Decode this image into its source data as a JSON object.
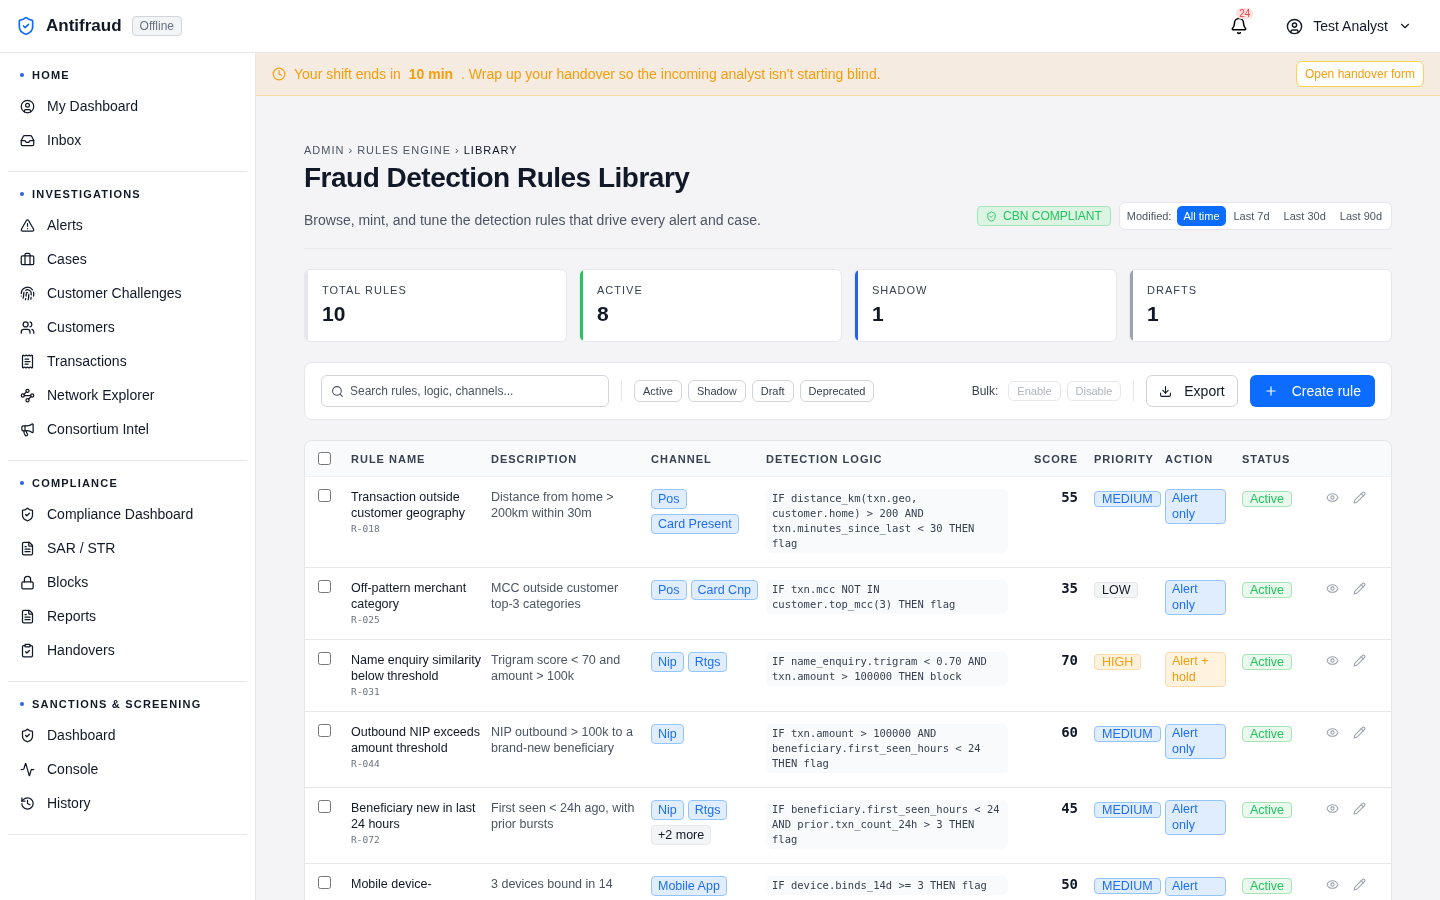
{
  "app": {
    "name": "Antifraud",
    "status": "Offline"
  },
  "header": {
    "notifications": "24",
    "user": "Test Analyst"
  },
  "sidebar": [
    {
      "title": "HOME",
      "items": [
        {
          "label": "My Dashboard"
        },
        {
          "label": "Inbox"
        }
      ]
    },
    {
      "title": "INVESTIGATIONS",
      "items": [
        {
          "label": "Alerts"
        },
        {
          "label": "Cases"
        },
        {
          "label": "Customer Challenges"
        },
        {
          "label": "Customers"
        },
        {
          "label": "Transactions"
        },
        {
          "label": "Network Explorer"
        },
        {
          "label": "Consortium Intel"
        }
      ]
    },
    {
      "title": "COMPLIANCE",
      "items": [
        {
          "label": "Compliance Dashboard"
        },
        {
          "label": "SAR / STR"
        },
        {
          "label": "Blocks"
        },
        {
          "label": "Reports"
        },
        {
          "label": "Handovers"
        }
      ]
    },
    {
      "title": "SANCTIONS & SCREENING",
      "items": [
        {
          "label": "Dashboard"
        },
        {
          "label": "Console"
        },
        {
          "label": "History"
        }
      ]
    }
  ],
  "banner": {
    "text": "Your shift ends in **10 min** . Wrap up your handover so the incoming analyst isn't starting blind.",
    "button": "Open handover form"
  },
  "breadcrumb": {
    "items": [
      "ADMIN",
      "RULES ENGINE",
      "LIBRARY"
    ],
    "separator": "›"
  },
  "title": "Fraud Detection Rules Library",
  "subtitle": "Browse, mint, and tune the detection rules that drive every alert and case.",
  "compliance_badge": "CBN COMPLIANT",
  "modified_filter": {
    "label": "Modified:",
    "options": [
      {
        "label": "All time",
        "selected": true
      },
      {
        "label": "Last 7d",
        "selected": false
      },
      {
        "label": "Last 30d",
        "selected": false
      },
      {
        "label": "Last 90d",
        "selected": false
      }
    ]
  },
  "stats": [
    {
      "label": "TOTAL RULES",
      "value": "10",
      "color": "#e5e7eb"
    },
    {
      "label": "ACTIVE",
      "value": "8",
      "color": "#22c55e"
    },
    {
      "label": "SHADOW",
      "value": "1",
      "color": "#2563eb"
    },
    {
      "label": "DRAFTS",
      "value": "1",
      "color": "#9ca3af"
    }
  ],
  "toolbar": {
    "search_placeholder": "Search rules, logic, channels...",
    "status_filters": [
      "Active",
      "Shadow",
      "Draft",
      "Deprecated"
    ],
    "bulk_label": "Bulk:",
    "bulk_actions": [
      {
        "label": "Enable",
        "disabled": true
      },
      {
        "label": "Disable",
        "disabled": true
      }
    ],
    "export": "Export",
    "create": "Create rule"
  },
  "table": {
    "all_checked": false,
    "columns": [
      "RULE NAME",
      "DESCRIPTION",
      "CHANNEL",
      "DETECTION LOGIC",
      "SCORE",
      "PRIORITY",
      "ACTION",
      "STATUS"
    ],
    "rows": [
      {
        "checked": false,
        "name": "Transaction outside customer geography",
        "id": "R-018",
        "description": "Distance from home > 200km within 30m",
        "channels": [
          {
            "label": "Pos",
            "kind": "channel"
          },
          {
            "label": "Card Present",
            "kind": "channel"
          }
        ],
        "logic": "IF distance_km(txn.geo, customer.home) > 200 AND txn.minutes_since_last < 30 THEN flag",
        "score": "55",
        "priority": {
          "label": "MEDIUM",
          "kind": "medium"
        },
        "action": {
          "label": "Alert only",
          "kind": "alert"
        },
        "status": {
          "label": "Active",
          "kind": "active"
        }
      },
      {
        "checked": false,
        "name": "Off-pattern merchant category",
        "id": "R-025",
        "description": "MCC outside customer top-3 categories",
        "channels": [
          {
            "label": "Pos",
            "kind": "channel"
          },
          {
            "label": "Card Cnp",
            "kind": "channel"
          }
        ],
        "logic": "IF txn.mcc NOT IN customer.top_mcc(3) THEN flag",
        "score": "35",
        "priority": {
          "label": "LOW",
          "kind": "low"
        },
        "action": {
          "label": "Alert only",
          "kind": "alert"
        },
        "status": {
          "label": "Active",
          "kind": "active"
        }
      },
      {
        "checked": false,
        "name": "Name enquiry similarity below threshold",
        "id": "R-031",
        "description": "Trigram score < 70 and amount > 100k",
        "channels": [
          {
            "label": "Nip",
            "kind": "channel"
          },
          {
            "label": "Rtgs",
            "kind": "channel"
          }
        ],
        "logic": "IF name_enquiry.trigram < 0.70 AND txn.amount > 100000 THEN block",
        "score": "70",
        "priority": {
          "label": "HIGH",
          "kind": "high"
        },
        "action": {
          "label": "Alert + hold",
          "kind": "hold"
        },
        "status": {
          "label": "Active",
          "kind": "active"
        }
      },
      {
        "checked": false,
        "name": "Outbound NIP exceeds amount threshold",
        "id": "R-044",
        "description": "NIP outbound > 100k to a brand-new beneficiary",
        "channels": [
          {
            "label": "Nip",
            "kind": "channel"
          }
        ],
        "logic": "IF txn.amount > 100000 AND beneficiary.first_seen_hours < 24 THEN flag",
        "score": "60",
        "priority": {
          "label": "MEDIUM",
          "kind": "medium"
        },
        "action": {
          "label": "Alert only",
          "kind": "alert"
        },
        "status": {
          "label": "Active",
          "kind": "active"
        }
      },
      {
        "checked": false,
        "name": "Beneficiary new in last 24 hours",
        "id": "R-072",
        "description": "First seen < 24h ago, with prior bursts",
        "channels": [
          {
            "label": "Nip",
            "kind": "channel"
          },
          {
            "label": "Rtgs",
            "kind": "channel"
          },
          {
            "label": "+2 more",
            "kind": "more"
          }
        ],
        "logic": "IF beneficiary.first_seen_hours < 24 AND prior.txn_count_24h > 3 THEN flag",
        "score": "45",
        "priority": {
          "label": "MEDIUM",
          "kind": "medium"
        },
        "action": {
          "label": "Alert only",
          "kind": "alert"
        },
        "status": {
          "label": "Active",
          "kind": "active"
        }
      },
      {
        "checked": false,
        "name": "Mobile device-",
        "description": "3 devices bound in 14",
        "channels": [
          {
            "label": "Mobile App",
            "kind": "channel"
          }
        ],
        "logic": "IF device.binds_14d >= 3 THEN flag",
        "score": "50",
        "priority": {
          "label": "MEDIUM",
          "kind": "medium"
        },
        "action": {
          "label": "Alert",
          "kind": "alert"
        },
        "status": {
          "label": "Active",
          "kind": "active"
        }
      }
    ]
  }
}
